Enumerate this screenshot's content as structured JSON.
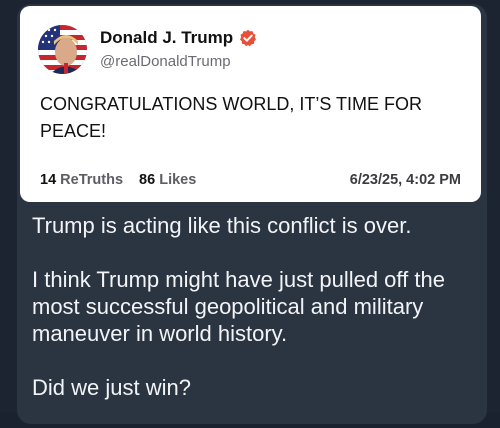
{
  "post": {
    "display_name": "Donald J. Trump",
    "handle": "@realDonaldTrump",
    "text": "CONGRATULATIONS WORLD, IT’S TIME FOR PEACE!",
    "retruths_count": "14",
    "retruths_label": "ReTruths",
    "likes_count": "86",
    "likes_label": "Likes",
    "timestamp": "6/23/25, 4:02 PM",
    "verified_badge_icon": "verified-badge-icon",
    "accent_color": "#e8503a"
  },
  "caption": {
    "line1": "Trump is acting like this conflict is over.",
    "line2": "I think Trump might have just pulled off the most successful geopolitical and military maneuver in world history.",
    "line3": "Did we just win?"
  }
}
